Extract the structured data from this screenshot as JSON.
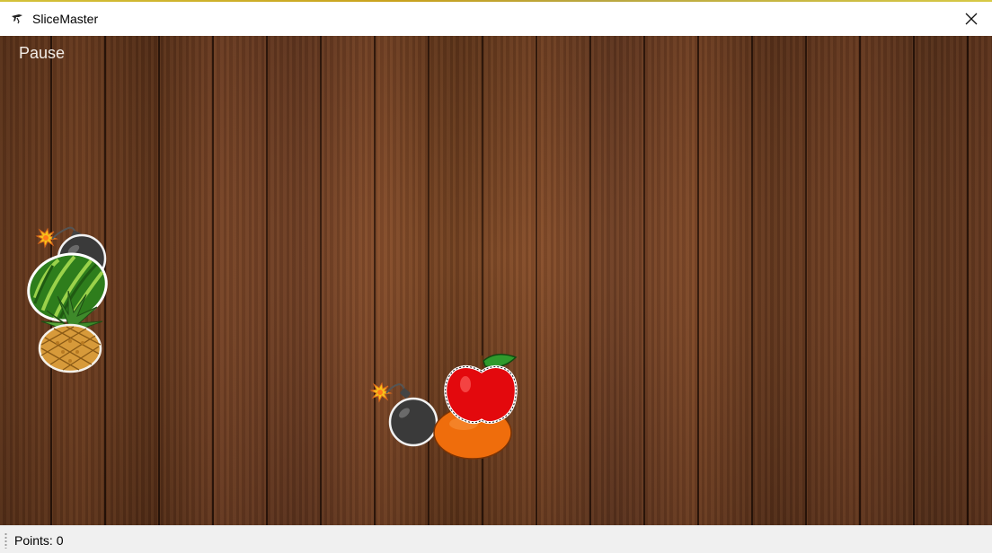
{
  "window": {
    "title": "SliceMaster",
    "app_icon": "fruit-slice-icon",
    "close_icon": "close-icon"
  },
  "game": {
    "pause_label": "Pause",
    "sprites": [
      {
        "kind": "bomb",
        "icon": "bomb-icon"
      },
      {
        "kind": "watermelon",
        "icon": "watermelon-icon"
      },
      {
        "kind": "pineapple",
        "icon": "pineapple-icon"
      },
      {
        "kind": "bomb",
        "icon": "bomb-icon"
      },
      {
        "kind": "orange",
        "icon": "orange-icon"
      },
      {
        "kind": "apple",
        "icon": "apple-icon"
      }
    ]
  },
  "status": {
    "points_text": "Points: 0"
  }
}
